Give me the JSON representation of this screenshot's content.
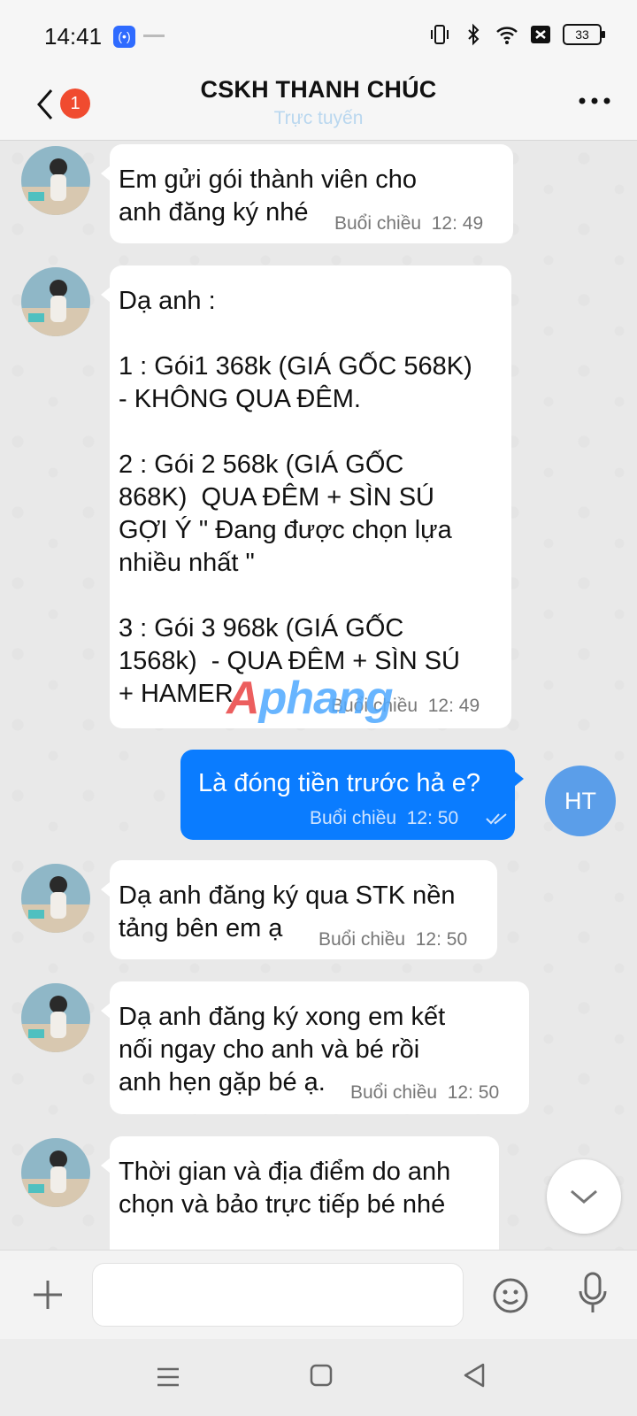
{
  "status_bar": {
    "time": "14:41",
    "app_icon_1": "(•)",
    "battery": "33",
    "icons": [
      "vibrate-icon",
      "bluetooth-icon",
      "wifi-icon",
      "sim-x-icon",
      "battery-icon"
    ]
  },
  "header": {
    "title": "CSKH THANH CHÚC",
    "subtitle": "Trực tuyến",
    "back_badge": "1"
  },
  "messages": [
    {
      "from": "contact",
      "text": "Em gửi gói thành viên cho\nanh đăng ký nhé",
      "time_label": "Buổi chiều",
      "time": "12: 49"
    },
    {
      "from": "contact",
      "text": "Dạ anh :\n\n1 : Gói1 368k (GIÁ GỐC 568K)\n- KHÔNG QUA ĐÊM.\n\n2 : Gói 2 568k (GIÁ GỐC\n868K)  QUA ĐÊM + SÌN SÚ\nGỢI Ý \" Đang được chọn lựa\nnhiều nhất \"\n\n3 : Gói 3 968k (GIÁ GỐC\n1568k)  - QUA ĐÊM + SÌN SÚ\n+ HAMER",
      "time_label": "Buổi chiều",
      "time": "12: 49"
    },
    {
      "from": "me",
      "text": "Là đóng tiền trước hả e?",
      "time_label": "Buổi chiều",
      "time": "12: 50"
    },
    {
      "from": "contact",
      "text": "Dạ anh đăng ký qua STK nền\ntảng bên em ạ",
      "time_label": "Buổi chiều",
      "time": "12: 50"
    },
    {
      "from": "contact",
      "text": "Dạ anh đăng ký xong em kết\nnối ngay cho anh và bé rồi\nanh hẹn gặp bé ạ.",
      "time_label": "Buổi chiều",
      "time": "12: 50"
    },
    {
      "from": "contact",
      "text": "Thời gian và địa điểm do anh\nchọn và bảo trực tiếp bé nhé",
      "time_label": "",
      "time": ""
    }
  ],
  "me_avatar": "HT",
  "watermark": {
    "a": "A",
    "rest": "phang"
  },
  "composer": {
    "placeholder": ""
  },
  "colors": {
    "outgoing_bubble": "#0a7cff",
    "badge": "#f04b2f",
    "me_avatar": "#5b9ee9"
  }
}
